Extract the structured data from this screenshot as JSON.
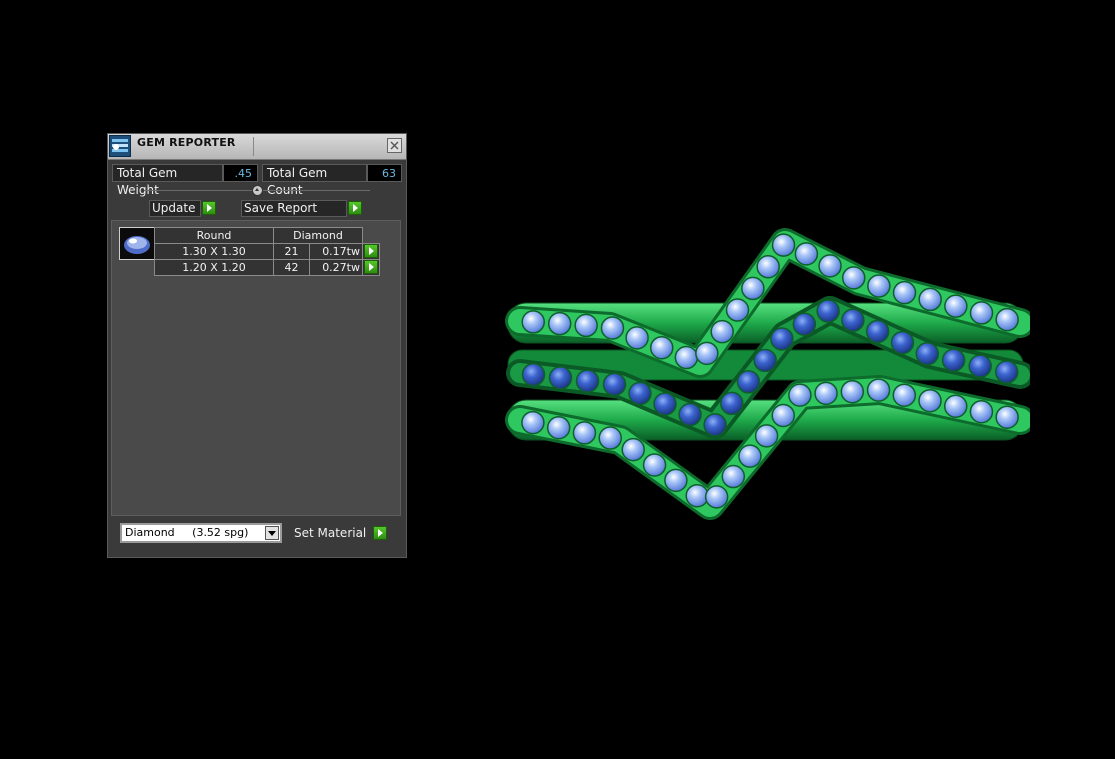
{
  "panel": {
    "title": "GEM REPORTER",
    "total_weight_label": "Total Gem Weight",
    "total_weight_value": ".45",
    "total_count_label": "Total Gem Count",
    "total_count_value": "63",
    "update_label": "Update",
    "save_report_label": "Save Report",
    "table": {
      "headers": [
        "Round",
        "Diamond"
      ],
      "rows": [
        {
          "size": "1.30 X 1.30",
          "count": "21",
          "weight": "0.17tw"
        },
        {
          "size": "1.20 X 1.20",
          "count": "42",
          "weight": "0.27tw"
        }
      ]
    },
    "material_select_value": "Diamond     (3.52 spg)",
    "set_material_label": "Set Material"
  },
  "colors": {
    "metal_green": "#1fae4a",
    "gem_light_blue": "#8fb4f0",
    "gem_dark_blue": "#2f57c8",
    "accent_value_blue": "#6fb7e0"
  },
  "icons": [
    "gem-reporter-icon",
    "close-icon",
    "slider-knob-icon",
    "play-icon",
    "dropdown-arrow-icon",
    "round-gem-icon"
  ]
}
